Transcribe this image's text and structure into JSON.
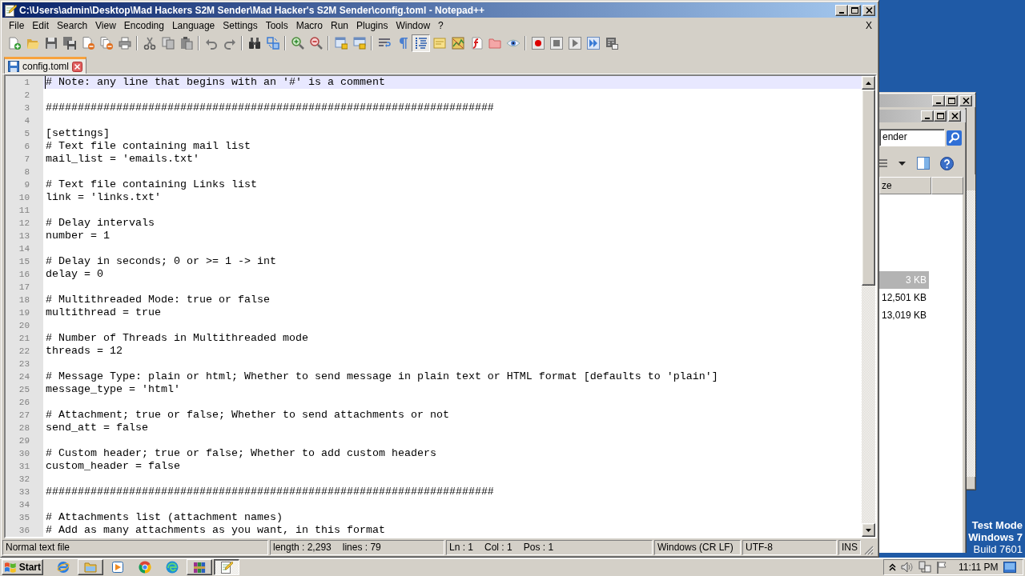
{
  "notepad_window": {
    "title": "C:\\Users\\admin\\Desktop\\Mad Hackers S2M Sender\\Mad Hacker's S2M Sender\\config.toml - Notepad++",
    "menu": [
      "File",
      "Edit",
      "Search",
      "View",
      "Encoding",
      "Language",
      "Settings",
      "Tools",
      "Macro",
      "Run",
      "Plugins",
      "Window",
      "?"
    ],
    "close_document": "X",
    "toolbar": [
      {
        "selected": false
      },
      {
        "selected": false
      },
      {
        "selected": false
      },
      {
        "selected": false
      },
      {
        "selected": false
      },
      {
        "selected": false
      },
      {
        "selected": false
      },
      {
        "selected": false
      },
      {
        "selected": false
      },
      {
        "selected": false
      },
      {
        "selected": false
      },
      {
        "selected": false
      },
      {
        "selected": false
      },
      {
        "selected": false
      },
      {
        "selected": false
      },
      {
        "selected": false
      },
      {
        "selected": false
      },
      {
        "selected": false
      },
      {
        "selected": false
      },
      {
        "selected": false
      },
      {
        "selected": true
      },
      {
        "selected": false
      },
      {
        "selected": false
      },
      {
        "selected": false
      },
      {
        "selected": false
      },
      {
        "selected": false
      },
      {
        "selected": false
      },
      {
        "selected": false
      },
      {
        "selected": false
      },
      {
        "selected": false
      },
      {
        "selected": false
      }
    ],
    "tabs": [
      {
        "label": "config.toml",
        "selected": true
      }
    ],
    "editor": {
      "lines": [
        {
          "number": "1",
          "text": "# Note: any line that begins with an '#' is a comment",
          "current": true
        },
        {
          "number": "2",
          "current": false
        },
        {
          "number": "3",
          "text": "######################################################################",
          "current": false
        },
        {
          "number": "4",
          "current": false
        },
        {
          "number": "5",
          "text": "[settings]",
          "current": false
        },
        {
          "number": "6",
          "text": "# Text file containing mail list",
          "current": false
        },
        {
          "number": "7",
          "text": "mail_list = 'emails.txt'",
          "current": false
        },
        {
          "number": "8",
          "current": false
        },
        {
          "number": "9",
          "text": "# Text file containing Links list",
          "current": false
        },
        {
          "number": "10",
          "text": "link = 'links.txt'",
          "current": false
        },
        {
          "number": "11",
          "current": false
        },
        {
          "number": "12",
          "text": "# Delay intervals",
          "current": false
        },
        {
          "number": "13",
          "text": "number = 1",
          "current": false
        },
        {
          "number": "14",
          "current": false
        },
        {
          "number": "15",
          "text": "# Delay in seconds; 0 or >= 1 -> int",
          "current": false
        },
        {
          "number": "16",
          "text": "delay = 0",
          "current": false
        },
        {
          "number": "17",
          "current": false
        },
        {
          "number": "18",
          "text": "# Multithreaded Mode: true or false",
          "current": false
        },
        {
          "number": "19",
          "text": "multithread = true",
          "current": false
        },
        {
          "number": "20",
          "current": false
        },
        {
          "number": "21",
          "text": "# Number of Threads in Multithreaded mode",
          "current": false
        },
        {
          "number": "22",
          "text": "threads = 12",
          "current": false
        },
        {
          "number": "23",
          "current": false
        },
        {
          "number": "24",
          "text": "# Message Type: plain or html; Whether to send message in plain text or HTML format [defaults to 'plain']",
          "current": false
        },
        {
          "number": "25",
          "text": "message_type = 'html'",
          "current": false
        },
        {
          "number": "26",
          "current": false
        },
        {
          "number": "27",
          "text": "# Attachment; true or false; Whether to send attachments or not",
          "current": false
        },
        {
          "number": "28",
          "text": "send_att = false",
          "current": false
        },
        {
          "number": "29",
          "current": false
        },
        {
          "number": "30",
          "text": "# Custom header; true or false; Whether to add custom headers",
          "current": false
        },
        {
          "number": "31",
          "text": "custom_header = false",
          "current": false
        },
        {
          "number": "32",
          "current": false
        },
        {
          "number": "33",
          "text": "######################################################################",
          "current": false
        },
        {
          "number": "34",
          "current": false
        },
        {
          "number": "35",
          "text": "# Attachments list (attachment names)",
          "current": false
        },
        {
          "number": "36",
          "text": "# Add as many attachments as you want, in this format",
          "current": false
        }
      ]
    },
    "status_bar": [
      {
        "items": [
          "Normal text file"
        ]
      },
      {
        "items": [
          "length : 2,293",
          "lines : 79"
        ]
      },
      {
        "items": [
          "Ln : 1",
          "Col : 1",
          "Pos : 1"
        ]
      },
      {
        "items": [
          "Windows (CR LF)"
        ]
      },
      {
        "items": [
          "UTF-8"
        ]
      },
      {
        "items": [
          "INS"
        ]
      }
    ]
  },
  "explorer_window": {
    "search_value": "ender",
    "columns": [
      "ze"
    ],
    "rows": [
      {
        "size": "3 KB",
        "selected": true
      },
      {
        "size": "12,501 KB",
        "selected": false
      },
      {
        "size": "13,019 KB",
        "selected": false
      }
    ]
  },
  "desktop_text": [
    {
      "text": "Test Mode",
      "bold": true
    },
    {
      "text": "Windows 7",
      "bold": true
    },
    {
      "text": "Build 7601",
      "bold": false
    }
  ],
  "taskbar": {
    "start": "Start",
    "apps": [
      {
        "running": false,
        "active": false
      },
      {
        "running": true,
        "active": false
      },
      {
        "running": false,
        "active": false
      },
      {
        "running": false,
        "active": false
      },
      {
        "running": false,
        "active": false
      },
      {
        "running": true,
        "active": false
      },
      {
        "running": true,
        "active": true
      }
    ],
    "clock": "11:11 PM"
  }
}
